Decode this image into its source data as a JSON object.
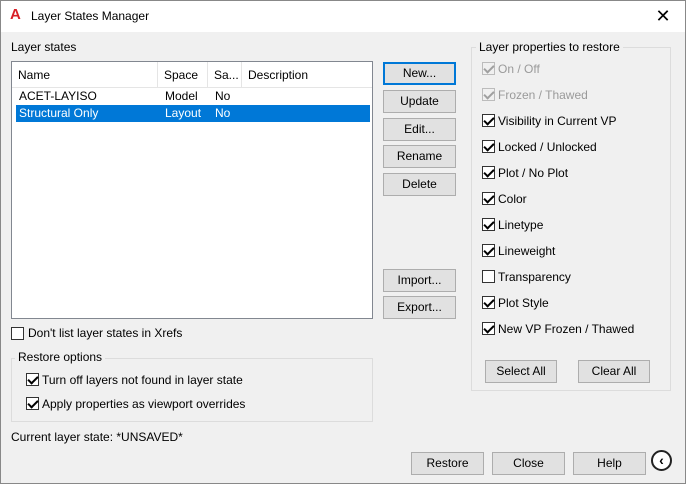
{
  "window": {
    "title": "Layer States Manager",
    "close_glyph": "✕",
    "app_icon_glyph": "A"
  },
  "layer_states": {
    "group_label": "Layer states",
    "columns": [
      "Name",
      "Space",
      "Sa...",
      "Description"
    ],
    "rows": [
      {
        "name": "ACET-LAYISO",
        "space": "Model",
        "saved": "No",
        "description": "",
        "selected": false
      },
      {
        "name": "Structural Only",
        "space": "Layout",
        "saved": "No",
        "description": "",
        "selected": true
      }
    ]
  },
  "buttons": {
    "new": "New...",
    "update": "Update",
    "edit": "Edit...",
    "rename": "Rename",
    "delete": "Delete",
    "import": "Import...",
    "export": "Export...",
    "restore": "Restore",
    "close": "Close",
    "help": "Help",
    "select_all": "Select All",
    "clear_all": "Clear All"
  },
  "dont_list_xrefs": {
    "label": "Don't list layer states in Xrefs",
    "checked": false
  },
  "restore_options": {
    "title": "Restore options",
    "items": [
      {
        "label": "Turn off layers not found in layer state",
        "checked": true
      },
      {
        "label": "Apply properties as viewport overrides",
        "checked": true
      }
    ]
  },
  "current_state": "Current layer state: *UNSAVED*",
  "properties": {
    "title": "Layer properties to restore",
    "items": [
      {
        "label": "On / Off",
        "checked": true,
        "disabled": true
      },
      {
        "label": "Frozen / Thawed",
        "checked": true,
        "disabled": true
      },
      {
        "label": "Visibility in Current VP",
        "checked": true,
        "disabled": false
      },
      {
        "label": "Locked / Unlocked",
        "checked": true,
        "disabled": false
      },
      {
        "label": "Plot / No Plot",
        "checked": true,
        "disabled": false
      },
      {
        "label": "Color",
        "checked": true,
        "disabled": false
      },
      {
        "label": "Linetype",
        "checked": true,
        "disabled": false
      },
      {
        "label": "Lineweight",
        "checked": true,
        "disabled": false
      },
      {
        "label": "Transparency",
        "checked": false,
        "disabled": false
      },
      {
        "label": "Plot Style",
        "checked": true,
        "disabled": false
      },
      {
        "label": "New VP Frozen / Thawed",
        "checked": true,
        "disabled": false
      }
    ]
  },
  "collapse_glyph": "‹",
  "colors": {
    "selection": "#0078d7",
    "app_icon": "#d81f26"
  }
}
